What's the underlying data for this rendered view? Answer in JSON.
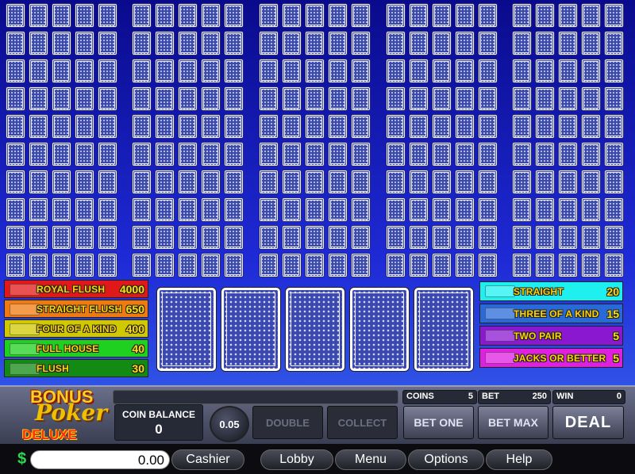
{
  "paytable": {
    "left": [
      {
        "name": "ROYAL FLUSH",
        "value": "4000",
        "color": "#e01818"
      },
      {
        "name": "STRAIGHT FLUSH",
        "value": "650",
        "color": "#f07a10"
      },
      {
        "name": "FOUR OF A KIND",
        "value": "400",
        "color": "#d0c800"
      },
      {
        "name": "FULL HOUSE",
        "value": "40",
        "color": "#20d020"
      },
      {
        "name": "FLUSH",
        "value": "30",
        "color": "#138a13"
      }
    ],
    "right": [
      {
        "name": "STRAIGHT",
        "value": "20",
        "color": "#1ef0f0"
      },
      {
        "name": "THREE OF A KIND",
        "value": "15",
        "color": "#2a6ad8"
      },
      {
        "name": "TWO PAIR",
        "value": "5",
        "color": "#8a18d0"
      },
      {
        "name": "JACKS OR BETTER",
        "value": "5",
        "color": "#e020e0"
      }
    ]
  },
  "logo": {
    "line1": "BONUS",
    "line2": "Poker",
    "line3": "DELUXE"
  },
  "coin_balance": {
    "label": "COIN BALANCE",
    "value": "0"
  },
  "denomination": "0.05",
  "buttons": {
    "double": "DOUBLE",
    "collect": "COLLECT",
    "bet_one": "BET ONE",
    "bet_max": "BET MAX",
    "deal": "DEAL"
  },
  "stats": {
    "coins_label": "COINS",
    "coins_value": "5",
    "bet_label": "BET",
    "bet_value": "250",
    "win_label": "WIN",
    "win_value": "0"
  },
  "bottom": {
    "currency": "$",
    "balance": "0.00",
    "cashier": "Cashier",
    "lobby": "Lobby",
    "menu": "Menu",
    "options": "Options",
    "help": "Help"
  }
}
